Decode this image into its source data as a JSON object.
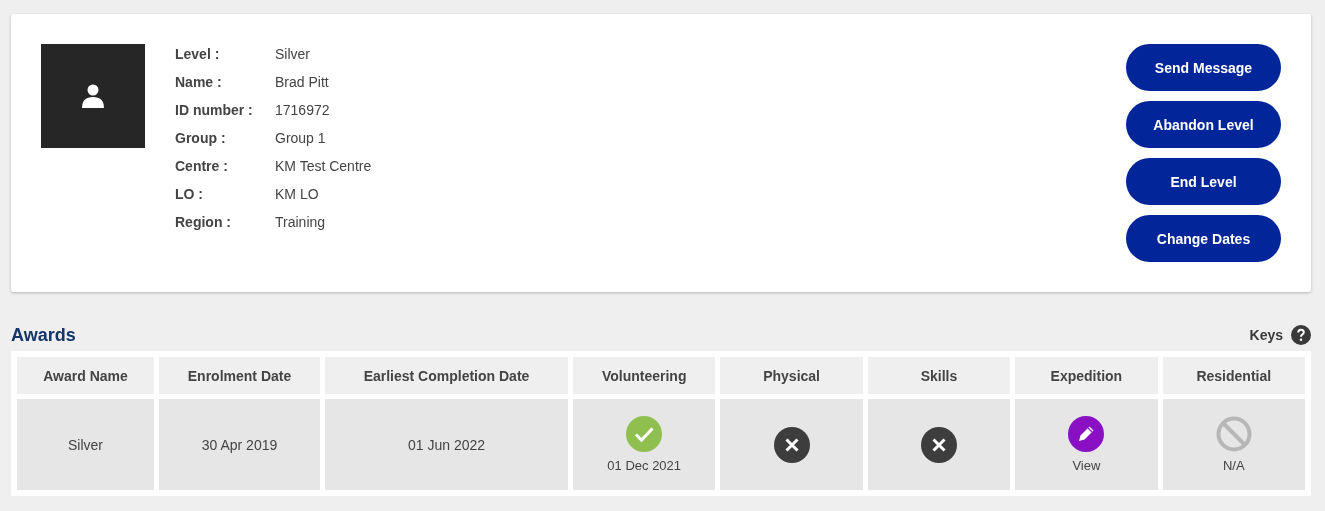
{
  "profile": {
    "details": [
      {
        "label": "Level :",
        "value": "Silver"
      },
      {
        "label": "Name :",
        "value": "Brad Pitt"
      },
      {
        "label": "ID number :",
        "value": "1716972"
      },
      {
        "label": "Group :",
        "value": "Group 1"
      },
      {
        "label": "Centre :",
        "value": "KM Test Centre"
      },
      {
        "label": "LO :",
        "value": "KM LO"
      },
      {
        "label": "Region :",
        "value": "Training"
      }
    ],
    "buttons": [
      "Send Message",
      "Abandon Level",
      "End Level",
      "Change Dates"
    ]
  },
  "awards": {
    "title": "Awards",
    "keys_label": "Keys",
    "table": {
      "columns": [
        "Award Name",
        "Enrolment Date",
        "Earliest Completion Date",
        "Volunteering",
        "Physical",
        "Skills",
        "Expedition",
        "Residential"
      ],
      "rows": [
        [
          {
            "kind": "text",
            "text": "Silver"
          },
          {
            "kind": "text",
            "text": "30 Apr 2019"
          },
          {
            "kind": "text",
            "text": "01 Jun 2022"
          },
          {
            "kind": "done",
            "text": "01 Dec 2021"
          },
          {
            "kind": "not_done"
          },
          {
            "kind": "not_done"
          },
          {
            "kind": "edit",
            "text": "View"
          },
          {
            "kind": "na",
            "text": "N/A"
          }
        ]
      ]
    }
  }
}
